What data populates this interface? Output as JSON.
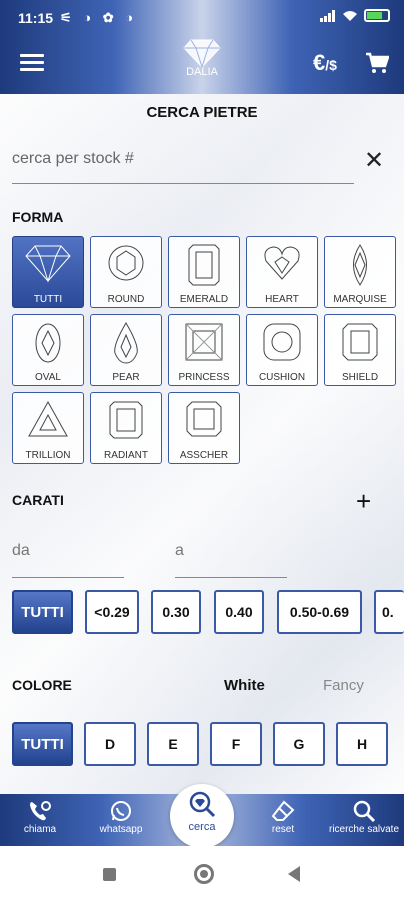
{
  "status": {
    "time": "11:15",
    "left_icons": "⚟ ◑ ✿ ◑",
    "battery_label": "battery"
  },
  "header": {
    "logo_text": "DALIA",
    "currency_main": "€",
    "currency_sub": "/$"
  },
  "page": {
    "title": "CERCA PIETRE"
  },
  "search": {
    "placeholder": "cerca per stock #"
  },
  "forma": {
    "heading": "FORMA",
    "shapes": [
      "TUTTI",
      "ROUND",
      "EMERALD",
      "HEART",
      "MARQUISE",
      "OVAL",
      "PEAR",
      "PRINCESS",
      "CUSHION",
      "SHIELD",
      "TRILLION",
      "RADIANT",
      "ASSCHER"
    ]
  },
  "carati": {
    "heading": "CARATI",
    "from_placeholder": "da",
    "to_placeholder": "a",
    "chips": [
      "TUTTI",
      "<0.29",
      "0.30",
      "0.40",
      "0.50-0.69",
      "0."
    ]
  },
  "colore": {
    "heading": "COLORE",
    "tab_white": "White",
    "tab_fancy": "Fancy",
    "chips": [
      "TUTTI",
      "D",
      "E",
      "F",
      "G",
      "H"
    ]
  },
  "bottom_nav": {
    "chiama": "chiama",
    "whatsapp": "whatsapp",
    "cerca": "cerca",
    "reset": "reset",
    "ricerche": "ricerche salvate"
  }
}
